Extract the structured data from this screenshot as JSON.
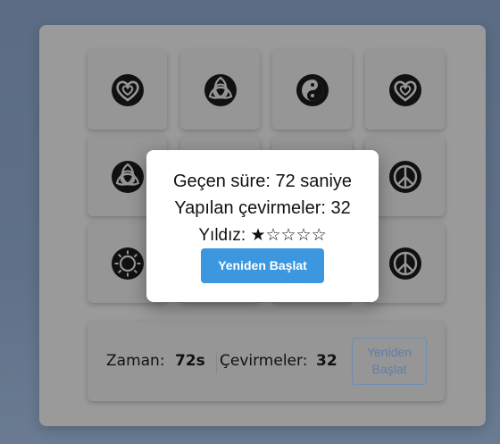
{
  "board": {
    "cards": [
      {
        "symbol": "heart-knot-icon"
      },
      {
        "symbol": "triquetra-icon"
      },
      {
        "symbol": "yin-yang-icon"
      },
      {
        "symbol": "heart-knot-icon"
      },
      {
        "symbol": "triquetra-icon"
      },
      {
        "symbol": "hidden"
      },
      {
        "symbol": "hidden"
      },
      {
        "symbol": "peace-icon"
      },
      {
        "symbol": "sun-icon"
      },
      {
        "symbol": "hidden"
      },
      {
        "symbol": "hidden"
      },
      {
        "symbol": "peace-icon"
      }
    ]
  },
  "stats": {
    "time_label": "Zaman:",
    "time_value": "72s",
    "moves_label": "Çevirmeler:",
    "moves_value": "32",
    "restart_label": "Yeniden Başlat"
  },
  "modal": {
    "time_line": "Geçen süre: 72 saniye",
    "moves_line": "Yapılan çevirmeler: 32",
    "stars_line": "Yıldız: ★☆☆☆☆",
    "restart_label": "Yeniden Başlat"
  }
}
